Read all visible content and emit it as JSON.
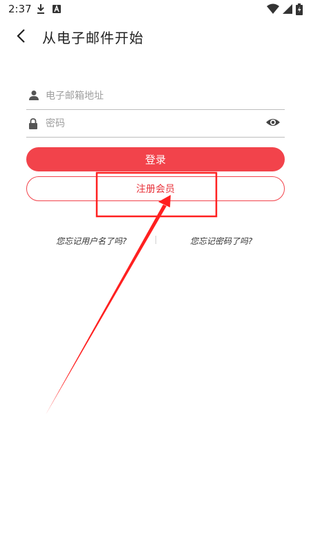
{
  "status_bar": {
    "time": "2:37",
    "icons": [
      "download-icon",
      "a-icon",
      "wifi-icon",
      "signal-icon",
      "battery-icon"
    ]
  },
  "header": {
    "title": "从电子邮件开始",
    "back_icon": "chevron-left-icon"
  },
  "form": {
    "email": {
      "placeholder": "电子邮箱地址",
      "value": "",
      "icon": "user-icon"
    },
    "password": {
      "placeholder": "密码",
      "value": "",
      "icon": "lock-icon",
      "toggle_icon": "eye-icon"
    },
    "login_label": "登录",
    "register_label": "注册会员"
  },
  "links": {
    "forgot_username": "您忘记用户名了吗?",
    "forgot_password": "您忘记密码了吗?"
  },
  "colors": {
    "accent": "#f2434b",
    "annotation": "#ff2020"
  }
}
